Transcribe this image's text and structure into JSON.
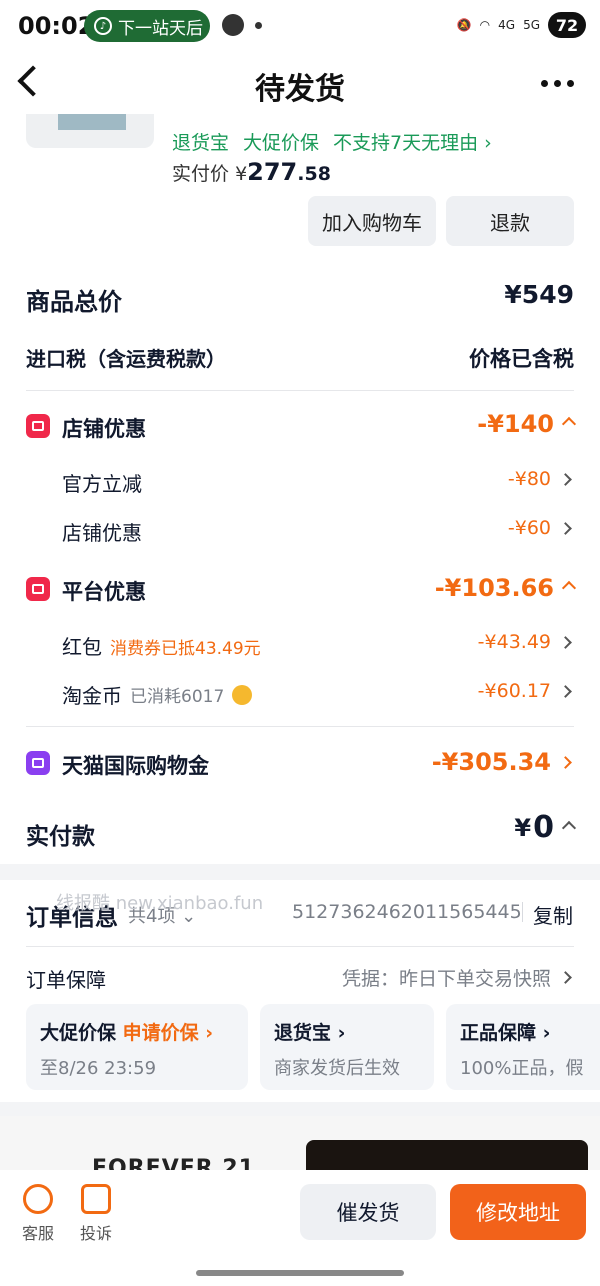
{
  "status_bar": {
    "time": "00:02",
    "now_playing": "下一站天后",
    "network_4g": "4G",
    "network_5g": "5G",
    "battery": "72"
  },
  "header": {
    "title": "待发货"
  },
  "product": {
    "tags": [
      "退货宝",
      "大促价保",
      "不支持7天无理由"
    ],
    "paid_label": "实付价",
    "paid_currency": "¥",
    "paid_int": "277",
    "paid_dec": ".58",
    "add_cart_label": "加入购物车",
    "refund_label": "退款"
  },
  "summary": {
    "goods_total_label": "商品总价",
    "goods_total_value": "¥549",
    "import_tax_label": "进口税（含运费税款）",
    "import_tax_value": "价格已含税"
  },
  "store_discount": {
    "label": "店铺优惠",
    "value": "-¥140",
    "items": [
      {
        "label": "官方立减",
        "value": "-¥80"
      },
      {
        "label": "店铺优惠",
        "value": "-¥60"
      }
    ]
  },
  "platform_discount": {
    "label": "平台优惠",
    "value": "-¥103.66",
    "items": [
      {
        "label": "红包",
        "note": "消费券已抵43.49元",
        "value": "-¥43.49"
      },
      {
        "label": "淘金币",
        "note": "已消耗6017",
        "value": "-¥60.17"
      }
    ]
  },
  "tmall_credit": {
    "label": "天猫国际购物金",
    "value": "-¥305.34"
  },
  "actual_paid": {
    "label": "实付款",
    "currency": "¥",
    "value": "0"
  },
  "order_info": {
    "title": "订单信息",
    "count": "共4项",
    "order_no": "5127362462011565445",
    "copy_label": "复制",
    "watermark": "线报酷 new.xianbao.fun"
  },
  "guarantee": {
    "label": "订单保障",
    "proof": "凭据：昨日下单交易快照",
    "cards": [
      {
        "title": "大促价保",
        "action": "申请价保",
        "sub": "至8/26 23:59"
      },
      {
        "title": "退货宝",
        "sub": "商家发货后生效"
      },
      {
        "title": "正品保障",
        "sub": "100%正品，假"
      }
    ]
  },
  "ad": {
    "brand": "FOREVER 21"
  },
  "bottom": {
    "service_label": "客服",
    "complain_label": "投诉",
    "urge_label": "催发货",
    "change_address_label": "修改地址"
  }
}
